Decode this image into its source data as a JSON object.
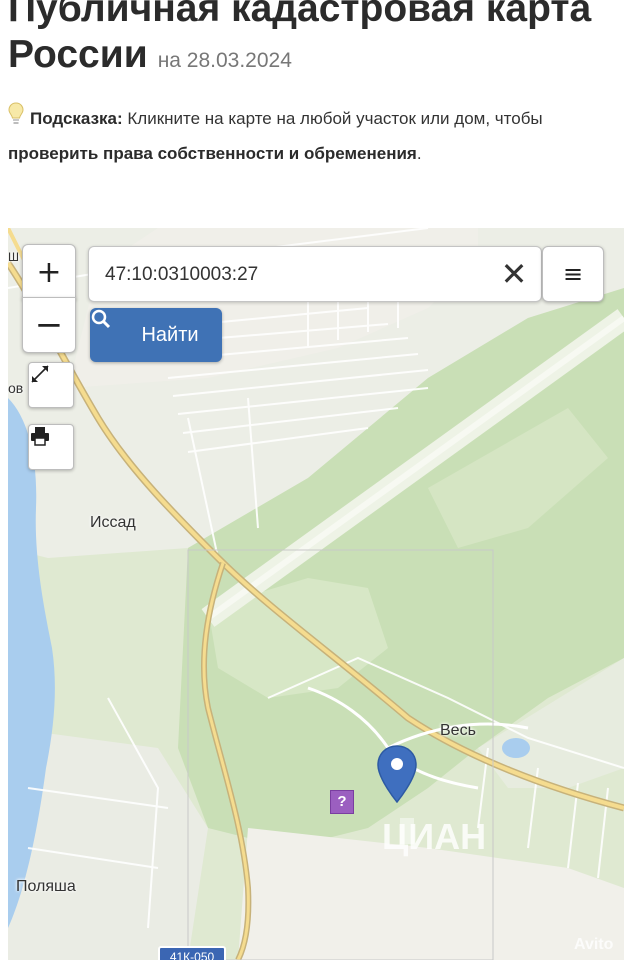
{
  "page": {
    "title": "Публичная кадастровая карта России",
    "date": "на 28.03.2024"
  },
  "hint": {
    "label": "Подсказка:",
    "text_before": " Кликните на карте на любой участок или дом, чтобы ",
    "emphasis": "проверить права собственности и обременения",
    "text_after": "."
  },
  "map": {
    "search_value": "47:10:0310003:27",
    "find_label": "Найти",
    "zoom_in_label": "+",
    "zoom_out_label": "−",
    "clear_label": "✕",
    "menu_label": "≡",
    "places": {
      "issad": "Иссад",
      "ves": "Весь",
      "polyasha": "Поляша",
      "edge_label": "ов",
      "edge_label_top": "Ш"
    },
    "road_badge": "41К-050",
    "parcel_marker": "?",
    "watermark_avito": "Avito",
    "watermark_cian": "ЦИАН"
  },
  "colors": {
    "accent_button": "#3f72b5",
    "pin": "#3f6fbf",
    "water": "#a9cdee",
    "forest": "#c9dfb6",
    "road": "#e8c66a",
    "parcel_marker": "#9b5fc0"
  },
  "icons": {
    "hint": "lightbulb-icon",
    "search": "magnifier-icon",
    "clear": "close-icon",
    "menu": "menu-icon",
    "fullscreen": "expand-icon",
    "print": "printer-icon",
    "pin": "map-pin-icon"
  }
}
